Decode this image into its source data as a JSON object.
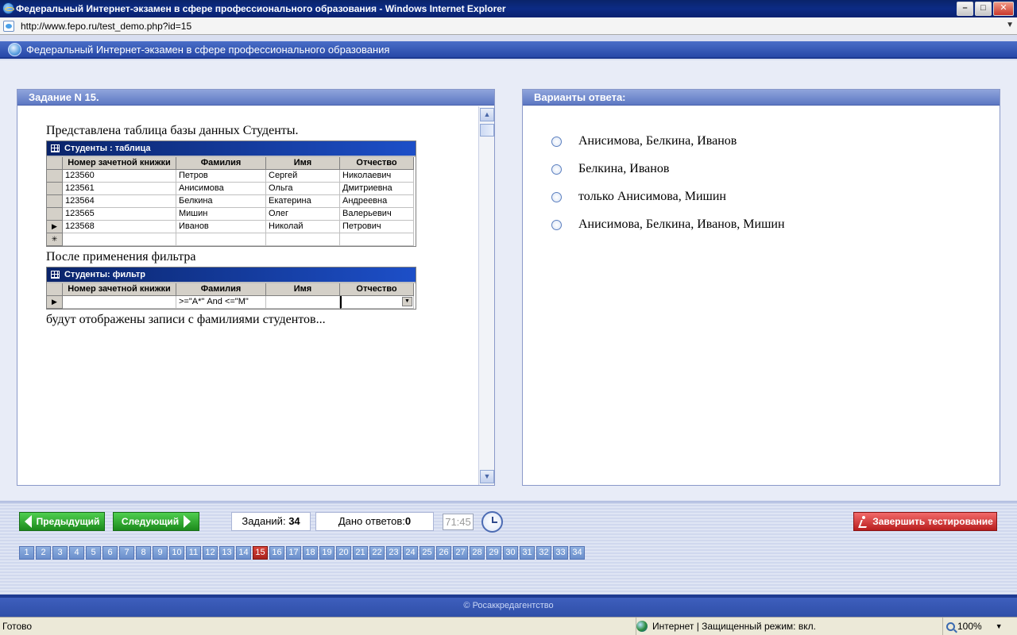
{
  "window": {
    "title": "Федеральный Интернет-экзамен в сфере профессионального образования - Windows Internet Explorer"
  },
  "address": {
    "url": "http://www.fepo.ru/test_demo.php?id=15"
  },
  "header": {
    "title": "Федеральный Интернет-экзамен в сфере профессионального образования"
  },
  "question": {
    "heading": "Задание N 15.",
    "intro": "Представлена таблица базы данных Студенты.",
    "table_title": "Студенты : таблица",
    "columns": [
      "Номер зачетной книжки",
      "Фамилия",
      "Имя",
      "Отчество"
    ],
    "rows": [
      [
        "123560",
        "Петров",
        "Сергей",
        "Николаевич"
      ],
      [
        "123561",
        "Анисимова",
        "Ольга",
        "Дмитриевна"
      ],
      [
        "123564",
        "Белкина",
        "Екатерина",
        "Андреевна"
      ],
      [
        "123565",
        "Мишин",
        "Олег",
        "Валерьевич"
      ],
      [
        "123568",
        "Иванов",
        "Николай",
        "Петрович"
      ]
    ],
    "middle": "После применения фильтра",
    "filter_title": "Студенты: фильтр",
    "filter_values": [
      "",
      ">=\"А*\" And <=\"М\"",
      "",
      ""
    ],
    "outro": "будут отображены записи с фамилиями студентов..."
  },
  "answers": {
    "heading": "Варианты ответа:",
    "options": [
      "Анисимова, Белкина, Иванов",
      "Белкина, Иванов",
      "только Анисимова, Мишин",
      "Анисимова, Белкина, Иванов, Мишин"
    ]
  },
  "toolbar": {
    "prev": "Предыдущий",
    "next": "Следующий",
    "tasks_label": "Заданий:",
    "tasks_count": "34",
    "answered_label": "Дано ответов:",
    "answered_count": "0",
    "timer": "71:45",
    "finish": "Завершить тестирование"
  },
  "pages": {
    "current": 15,
    "items": [
      "1",
      "2",
      "3",
      "4",
      "5",
      "6",
      "7",
      "8",
      "9",
      "10",
      "11",
      "12",
      "13",
      "14",
      "15",
      "16",
      "17",
      "18",
      "19",
      "20",
      "21",
      "22",
      "23",
      "24",
      "25",
      "26",
      "27",
      "28",
      "29",
      "30",
      "31",
      "32",
      "33",
      "34"
    ]
  },
  "footer": {
    "copyright": "© Росаккредагентство"
  },
  "status": {
    "left": "Готово",
    "zone": "Интернет | Защищенный режим: вкл.",
    "zoom": "100%"
  }
}
